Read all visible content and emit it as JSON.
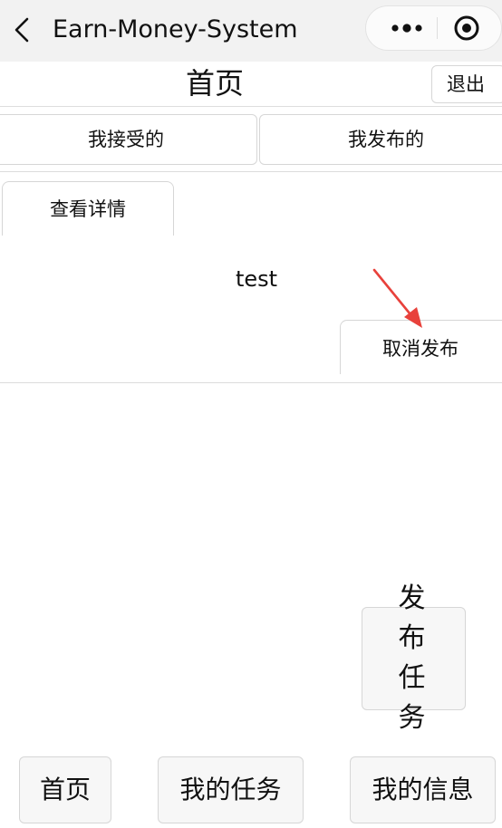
{
  "navbar": {
    "title": "Earn-Money-System",
    "back_icon": "chevron-left-icon",
    "more_icon": "more-dots-icon",
    "close_icon": "target-circle-icon"
  },
  "header": {
    "title": "首页",
    "logout_label": "退出"
  },
  "tabs": [
    {
      "label": "我接受的"
    },
    {
      "label": "我发布的"
    }
  ],
  "task": {
    "detail_label": "查看详情",
    "name": "test",
    "cancel_label": "取消发布",
    "annotation_arrow_color": "#e8413b"
  },
  "publish_label": "发布任务",
  "bottom_nav": [
    {
      "label": "首页"
    },
    {
      "label": "我的任务"
    },
    {
      "label": "我的信息"
    }
  ]
}
